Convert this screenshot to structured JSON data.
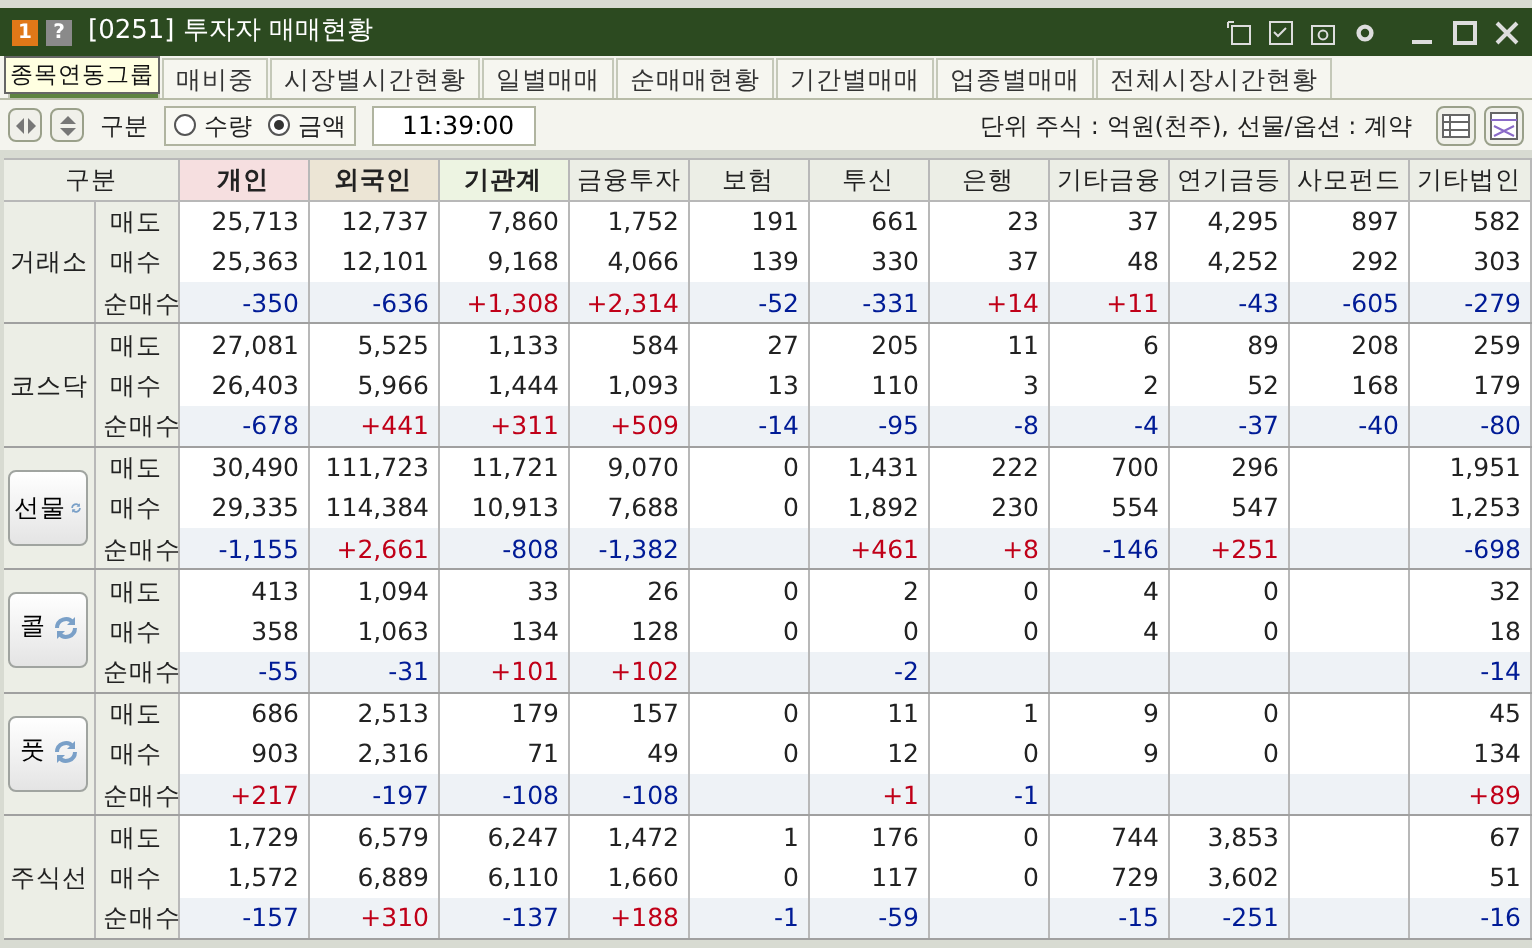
{
  "window": {
    "badge": "1",
    "help": "?",
    "title": "[0251] 투자자 매매현황"
  },
  "tooltip": "종목연동그룹",
  "tabs": [
    {
      "selected": true
    },
    {
      "label": "매비중",
      "selected": false
    },
    {
      "label": "시장별시간현황",
      "selected": false
    },
    {
      "label": "일별매매",
      "selected": false
    },
    {
      "label": "순매매현황",
      "selected": false
    },
    {
      "label": "기간별매매",
      "selected": false
    },
    {
      "label": "업종별매매",
      "selected": false
    },
    {
      "label": "전체시장시간현황",
      "selected": false
    }
  ],
  "toolbar": {
    "group_label": "구분",
    "options": [
      {
        "label": "수량",
        "selected": false
      },
      {
        "label": "금액",
        "selected": true
      }
    ],
    "time": "11:39:00",
    "unit": "단위 주식 : 억원(천주), 선물/옵션 : 계약"
  },
  "table": {
    "columns": [
      "구분",
      "개인",
      "외국인",
      "기관계",
      "금융투자",
      "보험",
      "투신",
      "은행",
      "기타금융",
      "연기금등",
      "사모펀드",
      "기타법인"
    ],
    "groups": [
      {
        "name": "거래소",
        "kind": "label",
        "rows": [
          {
            "label": "매도",
            "kind": "plain",
            "values": {
              "c1": "25,713",
              "c2": "12,737",
              "c3": "7,860",
              "c4": "1,752",
              "c5": "191",
              "c6": "661",
              "c7": "23",
              "c8": "37",
              "c9": "4,295",
              "c10": "897",
              "c11": "582"
            }
          },
          {
            "label": "매수",
            "kind": "plain",
            "values": {
              "c1": "25,363",
              "c2": "12,101",
              "c3": "9,168",
              "c4": "4,066",
              "c5": "139",
              "c6": "330",
              "c7": "37",
              "c8": "48",
              "c9": "4,252",
              "c10": "292",
              "c11": "303"
            }
          },
          {
            "label": "순매수",
            "kind": "net",
            "values": {
              "c1": "-350",
              "c2": "-636",
              "c3": "+1,308",
              "c4": "+2,314",
              "c5": "-52",
              "c6": "-331",
              "c7": "+14",
              "c8": "+11",
              "c9": "-43",
              "c10": "-605",
              "c11": "-279"
            },
            "up": {
              "c1": false,
              "c2": false,
              "c3": true,
              "c4": true,
              "c5": false,
              "c6": false,
              "c7": true,
              "c8": true,
              "c9": false,
              "c10": false,
              "c11": false
            }
          }
        ]
      },
      {
        "name": "코스닥",
        "kind": "label",
        "rows": [
          {
            "label": "매도",
            "kind": "plain",
            "values": {
              "c1": "27,081",
              "c2": "5,525",
              "c3": "1,133",
              "c4": "584",
              "c5": "27",
              "c6": "205",
              "c7": "11",
              "c8": "6",
              "c9": "89",
              "c10": "208",
              "c11": "259"
            }
          },
          {
            "label": "매수",
            "kind": "plain",
            "values": {
              "c1": "26,403",
              "c2": "5,966",
              "c3": "1,444",
              "c4": "1,093",
              "c5": "13",
              "c6": "110",
              "c7": "3",
              "c8": "2",
              "c9": "52",
              "c10": "168",
              "c11": "179"
            }
          },
          {
            "label": "순매수",
            "kind": "net",
            "values": {
              "c1": "-678",
              "c2": "+441",
              "c3": "+311",
              "c4": "+509",
              "c5": "-14",
              "c6": "-95",
              "c7": "-8",
              "c8": "-4",
              "c9": "-37",
              "c10": "-40",
              "c11": "-80"
            },
            "up": {
              "c1": false,
              "c2": true,
              "c3": true,
              "c4": true,
              "c5": false,
              "c6": false,
              "c7": false,
              "c8": false,
              "c9": false,
              "c10": false,
              "c11": false
            }
          }
        ]
      },
      {
        "name": "선물",
        "kind": "button",
        "rows": [
          {
            "label": "매도",
            "kind": "plain",
            "values": {
              "c1": "30,490",
              "c2": "111,723",
              "c3": "11,721",
              "c4": "9,070",
              "c5": "0",
              "c6": "1,431",
              "c7": "222",
              "c8": "700",
              "c9": "296",
              "c11": "1,951"
            }
          },
          {
            "label": "매수",
            "kind": "plain",
            "values": {
              "c1": "29,335",
              "c2": "114,384",
              "c3": "10,913",
              "c4": "7,688",
              "c5": "0",
              "c6": "1,892",
              "c7": "230",
              "c8": "554",
              "c9": "547",
              "c11": "1,253"
            }
          },
          {
            "label": "순매수",
            "kind": "net",
            "values": {
              "c1": "-1,155",
              "c2": "+2,661",
              "c3": "-808",
              "c4": "-1,382",
              "c6": "+461",
              "c7": "+8",
              "c8": "-146",
              "c9": "+251",
              "c11": "-698"
            },
            "up": {
              "c1": false,
              "c2": true,
              "c3": false,
              "c4": false,
              "c6": true,
              "c7": true,
              "c8": false,
              "c9": true,
              "c11": false
            }
          }
        ]
      },
      {
        "name": "콜",
        "kind": "option",
        "rows": [
          {
            "label": "매도",
            "kind": "plain",
            "values": {
              "c1": "413",
              "c2": "1,094",
              "c3": "33",
              "c4": "26",
              "c5": "0",
              "c6": "2",
              "c7": "0",
              "c8": "4",
              "c9": "0",
              "c11": "32"
            }
          },
          {
            "label": "매수",
            "kind": "plain",
            "values": {
              "c1": "358",
              "c2": "1,063",
              "c3": "134",
              "c4": "128",
              "c5": "0",
              "c6": "0",
              "c7": "0",
              "c8": "4",
              "c9": "0",
              "c11": "18"
            }
          },
          {
            "label": "순매수",
            "kind": "net",
            "values": {
              "c1": "-55",
              "c2": "-31",
              "c3": "+101",
              "c4": "+102",
              "c6": "-2",
              "c11": "-14"
            },
            "up": {
              "c1": false,
              "c2": false,
              "c3": true,
              "c4": true,
              "c6": false,
              "c11": false
            }
          }
        ]
      },
      {
        "name": "풋",
        "kind": "option",
        "rows": [
          {
            "label": "매도",
            "kind": "plain",
            "values": {
              "c1": "686",
              "c2": "2,513",
              "c3": "179",
              "c4": "157",
              "c5": "0",
              "c6": "11",
              "c7": "1",
              "c8": "9",
              "c9": "0",
              "c11": "45"
            }
          },
          {
            "label": "매수",
            "kind": "plain",
            "values": {
              "c1": "903",
              "c2": "2,316",
              "c3": "71",
              "c4": "49",
              "c5": "0",
              "c6": "12",
              "c7": "0",
              "c8": "9",
              "c9": "0",
              "c11": "134"
            }
          },
          {
            "label": "순매수",
            "kind": "net",
            "values": {
              "c1": "+217",
              "c2": "-197",
              "c3": "-108",
              "c4": "-108",
              "c6": "+1",
              "c7": "-1",
              "c11": "+89"
            },
            "up": {
              "c1": true,
              "c2": false,
              "c3": false,
              "c4": false,
              "c6": true,
              "c7": false,
              "c11": true
            }
          }
        ]
      },
      {
        "name": "주식선",
        "kind": "label",
        "rows": [
          {
            "label": "매도",
            "kind": "plain",
            "values": {
              "c1": "1,729",
              "c2": "6,579",
              "c3": "6,247",
              "c4": "1,472",
              "c5": "1",
              "c6": "176",
              "c7": "0",
              "c8": "744",
              "c9": "3,853",
              "c11": "67"
            }
          },
          {
            "label": "매수",
            "kind": "plain",
            "values": {
              "c1": "1,572",
              "c2": "6,889",
              "c3": "6,110",
              "c4": "1,660",
              "c5": "0",
              "c6": "117",
              "c7": "0",
              "c8": "729",
              "c9": "3,602",
              "c11": "51"
            }
          },
          {
            "label": "순매수",
            "kind": "net",
            "values": {
              "c1": "-157",
              "c2": "+310",
              "c3": "-137",
              "c4": "+188",
              "c5": "-1",
              "c6": "-59",
              "c8": "-15",
              "c9": "-251",
              "c11": "-16"
            },
            "up": {
              "c1": false,
              "c2": true,
              "c3": false,
              "c4": true,
              "c5": false,
              "c6": false,
              "c8": false,
              "c9": false,
              "c11": false
            }
          }
        ]
      }
    ]
  }
}
